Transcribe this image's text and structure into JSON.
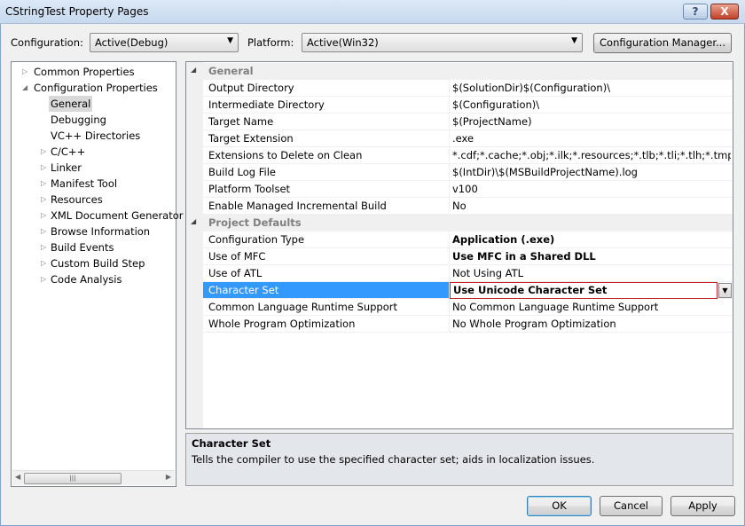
{
  "window": {
    "title": "CStringTest Property Pages",
    "help_label": "?",
    "close_label": "X"
  },
  "toolbar": {
    "configuration_label": "Configuration:",
    "configuration_value": "Active(Debug)",
    "platform_label": "Platform:",
    "platform_value": "Active(Win32)",
    "config_manager_label": "Configuration Manager..."
  },
  "tree": {
    "items": [
      {
        "label": "Common Properties",
        "expander": "▷"
      },
      {
        "label": "Configuration Properties",
        "expander": "◢"
      },
      {
        "label": "General",
        "expander": ""
      },
      {
        "label": "Debugging",
        "expander": ""
      },
      {
        "label": "VC++ Directories",
        "expander": ""
      },
      {
        "label": "C/C++",
        "expander": "▷"
      },
      {
        "label": "Linker",
        "expander": "▷"
      },
      {
        "label": "Manifest Tool",
        "expander": "▷"
      },
      {
        "label": "Resources",
        "expander": "▷"
      },
      {
        "label": "XML Document Generator",
        "expander": "▷"
      },
      {
        "label": "Browse Information",
        "expander": "▷"
      },
      {
        "label": "Build Events",
        "expander": "▷"
      },
      {
        "label": "Custom Build Step",
        "expander": "▷"
      },
      {
        "label": "Code Analysis",
        "expander": "▷"
      }
    ]
  },
  "grid": {
    "rows": [
      {
        "type": "cat",
        "name": "General"
      },
      {
        "name": "Output Directory",
        "value": "$(SolutionDir)$(Configuration)\\"
      },
      {
        "name": "Intermediate Directory",
        "value": "$(Configuration)\\"
      },
      {
        "name": "Target Name",
        "value": "$(ProjectName)"
      },
      {
        "name": "Target Extension",
        "value": ".exe"
      },
      {
        "name": "Extensions to Delete on Clean",
        "value": "*.cdf;*.cache;*.obj;*.ilk;*.resources;*.tlb;*.tli;*.tlh;*.tmp;*.rsp;*.pgc;*.pgd;*.meta;$(TargetPath)"
      },
      {
        "name": "Build Log File",
        "value": "$(IntDir)\\$(MSBuildProjectName).log"
      },
      {
        "name": "Platform Toolset",
        "value": "v100"
      },
      {
        "name": "Enable Managed Incremental Build",
        "value": "No"
      },
      {
        "type": "cat",
        "name": "Project Defaults"
      },
      {
        "name": "Configuration Type",
        "value": "Application (.exe)",
        "bold": true
      },
      {
        "name": "Use of MFC",
        "value": "Use MFC in a Shared DLL",
        "bold": true
      },
      {
        "name": "Use of ATL",
        "value": "Not Using ATL"
      },
      {
        "name": "Character Set",
        "value": "Use Unicode Character Set",
        "selected": true
      },
      {
        "name": "Common Language Runtime Support",
        "value": "No Common Language Runtime Support"
      },
      {
        "name": "Whole Program Optimization",
        "value": "No Whole Program Optimization"
      }
    ]
  },
  "description": {
    "title": "Character Set",
    "text": "Tells the compiler to use the specified character set; aids in localization issues."
  },
  "buttons": {
    "ok": "OK",
    "cancel": "Cancel",
    "apply": "Apply"
  }
}
